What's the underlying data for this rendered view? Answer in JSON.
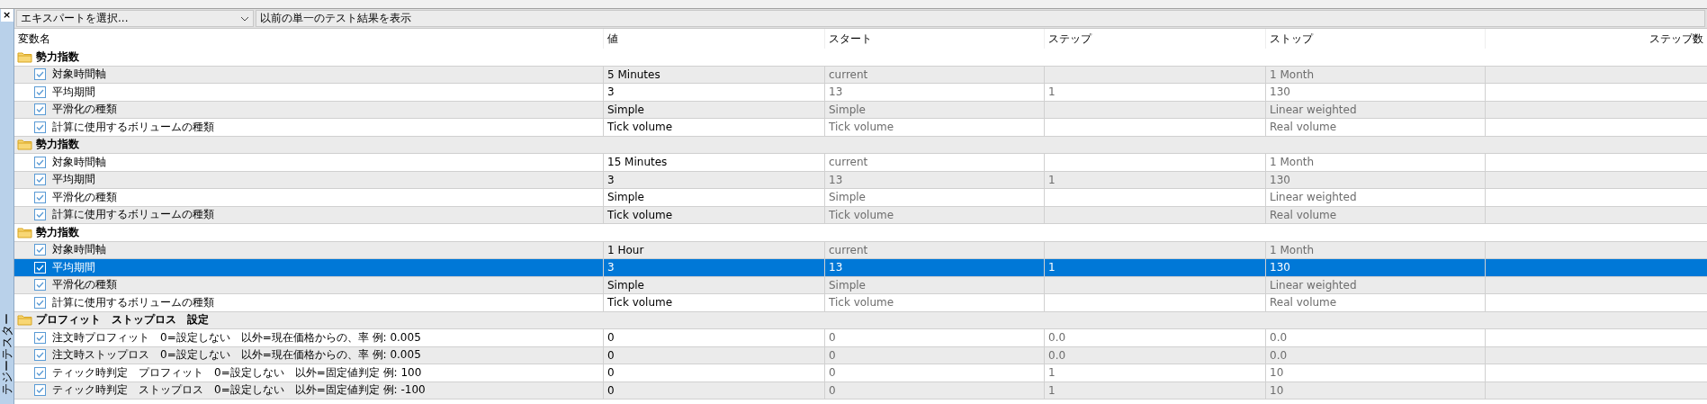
{
  "sidebar": {
    "close": "×",
    "title": "テジーテスター"
  },
  "toolbar": {
    "expert_select": {
      "value": "エキスパートを選択..."
    },
    "button": "以前の単一のテスト結果を表示"
  },
  "table": {
    "columns": [
      "変数名",
      "値",
      "スタート",
      "ステップ",
      "ストップ",
      "ステップ数"
    ],
    "groups": [
      {
        "name": "勢力指数",
        "rows": [
          {
            "name": "対象時間軸",
            "checked": true,
            "selected": false,
            "value": "5 Minutes",
            "start": "current",
            "step": "",
            "stop": "1 Month"
          },
          {
            "name": "平均期間",
            "checked": true,
            "selected": false,
            "value": "3",
            "start": "13",
            "step": "1",
            "stop": "130"
          },
          {
            "name": "平滑化の種類",
            "checked": true,
            "selected": false,
            "value": "Simple",
            "start": "Simple",
            "step": "",
            "stop": "Linear weighted"
          },
          {
            "name": "計算に使用するボリュームの種類",
            "checked": true,
            "selected": false,
            "value": "Tick volume",
            "start": "Tick volume",
            "step": "",
            "stop": "Real volume"
          }
        ]
      },
      {
        "name": "勢力指数",
        "rows": [
          {
            "name": "対象時間軸",
            "checked": true,
            "selected": false,
            "value": "15 Minutes",
            "start": "current",
            "step": "",
            "stop": "1 Month"
          },
          {
            "name": "平均期間",
            "checked": true,
            "selected": false,
            "value": "3",
            "start": "13",
            "step": "1",
            "stop": "130"
          },
          {
            "name": "平滑化の種類",
            "checked": true,
            "selected": false,
            "value": "Simple",
            "start": "Simple",
            "step": "",
            "stop": "Linear weighted"
          },
          {
            "name": "計算に使用するボリュームの種類",
            "checked": true,
            "selected": false,
            "value": "Tick volume",
            "start": "Tick volume",
            "step": "",
            "stop": "Real volume"
          }
        ]
      },
      {
        "name": "勢力指数",
        "rows": [
          {
            "name": "対象時間軸",
            "checked": true,
            "selected": false,
            "value": "1 Hour",
            "start": "current",
            "step": "",
            "stop": "1 Month"
          },
          {
            "name": "平均期間",
            "checked": true,
            "selected": true,
            "value": "3",
            "start": "13",
            "step": "1",
            "stop": "130"
          },
          {
            "name": "平滑化の種類",
            "checked": true,
            "selected": false,
            "value": "Simple",
            "start": "Simple",
            "step": "",
            "stop": "Linear weighted"
          },
          {
            "name": "計算に使用するボリュームの種類",
            "checked": true,
            "selected": false,
            "value": "Tick volume",
            "start": "Tick volume",
            "step": "",
            "stop": "Real volume"
          }
        ]
      },
      {
        "name": "プロフィット　ストップロス　設定",
        "rows": [
          {
            "name": "注文時プロフィット　0=設定しない　以外=現在価格からの、率 例: 0.005",
            "checked": true,
            "selected": false,
            "value": "0",
            "start": "0",
            "step": "0.0",
            "stop": "0.0"
          },
          {
            "name": "注文時ストップロス　0=設定しない　以外=現在価格からの、率 例: 0.005",
            "checked": true,
            "selected": false,
            "value": "0",
            "start": "0",
            "step": "0.0",
            "stop": "0.0"
          },
          {
            "name": "ティック時判定　プロフィット　0=設定しない　以外=固定値判定 例: 100",
            "checked": true,
            "selected": false,
            "value": "0",
            "start": "0",
            "step": "1",
            "stop": "10"
          },
          {
            "name": "ティック時判定　ストップロス　0=設定しない　以外=固定値判定 例: -100",
            "checked": true,
            "selected": false,
            "value": "0",
            "start": "0",
            "step": "1",
            "stop": "10"
          }
        ]
      }
    ]
  }
}
